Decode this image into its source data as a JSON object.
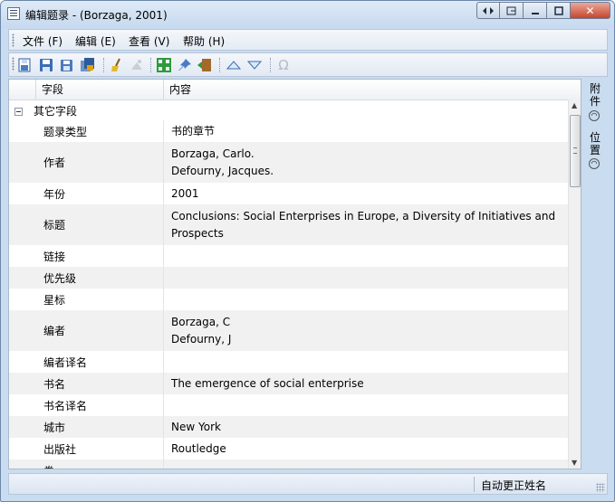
{
  "window": {
    "title": "编辑题录 - (Borzaga, 2001)"
  },
  "caption_buttons": {
    "close": "✕"
  },
  "menu": {
    "file": "文件 (F)",
    "edit": "编辑 (E)",
    "view": "查看 (V)",
    "help": "帮助 (H)"
  },
  "toolbar": {
    "omega": "Ω"
  },
  "grid": {
    "header_field": "字段",
    "header_content": "内容",
    "group_label": "其它字段",
    "rows": [
      {
        "field": "题录类型",
        "lines": [
          "书的章节"
        ]
      },
      {
        "field": "作者",
        "lines": [
          "Borzaga, Carlo.",
          "Defourny, Jacques."
        ]
      },
      {
        "field": "年份",
        "lines": [
          "2001"
        ]
      },
      {
        "field": "标题",
        "lines": [
          "Conclusions: Social Enterprises in Europe, a Diversity of Initiatives and",
          "Prospects"
        ]
      },
      {
        "field": "链接",
        "lines": []
      },
      {
        "field": "优先级",
        "lines": []
      },
      {
        "field": "星标",
        "lines": []
      },
      {
        "field": "编者",
        "lines": [
          "Borzaga, C",
          "Defourny, J"
        ]
      },
      {
        "field": "编者译名",
        "lines": []
      },
      {
        "field": "书名",
        "lines": [
          "The emergence of social enterprise"
        ]
      },
      {
        "field": "书名译名",
        "lines": []
      },
      {
        "field": "城市",
        "lines": [
          "New York"
        ]
      },
      {
        "field": "出版社",
        "lines": [
          "Routledge"
        ]
      },
      {
        "field": "卷",
        "lines": []
      }
    ]
  },
  "side_panel": {
    "attachments_label": "附件",
    "location_label": "位置"
  },
  "status_bar": {
    "auto_correct_names": "自动更正姓名"
  }
}
